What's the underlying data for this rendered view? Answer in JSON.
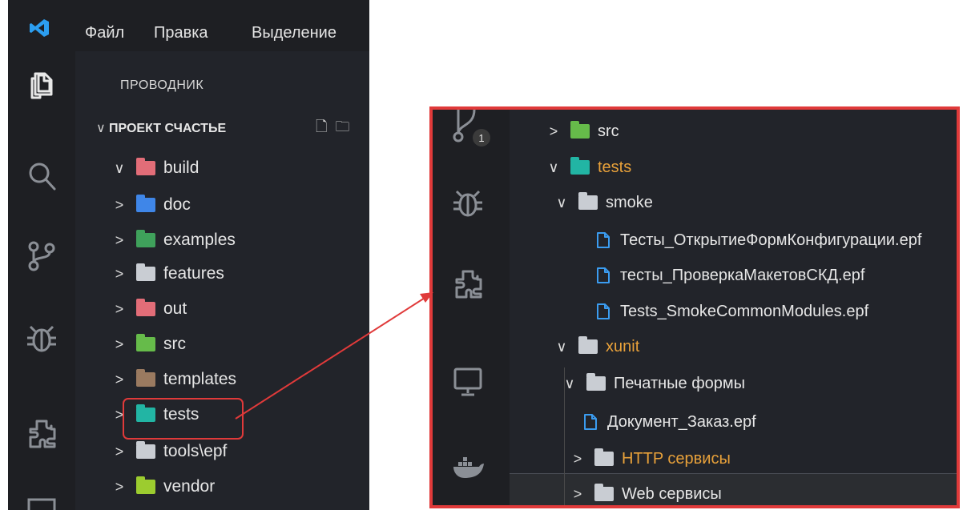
{
  "menu": {
    "items": [
      "Файл",
      "Правка",
      "Выделение"
    ]
  },
  "explorer": {
    "title": "ПРОВОДНИК",
    "project": "ПРОЕКТ СЧАСТЬЕ",
    "tree": [
      {
        "name": "build",
        "chev": "∨",
        "color": "#e26d78"
      },
      {
        "name": "doc",
        "chev": ">",
        "color": "#3f86e8"
      },
      {
        "name": "examples",
        "chev": ">",
        "color": "#3fa15b"
      },
      {
        "name": "features",
        "chev": ">",
        "color": "#c9cdd3"
      },
      {
        "name": "out",
        "chev": ">",
        "color": "#e26d78"
      },
      {
        "name": "src",
        "chev": ">",
        "color": "#66bb4a"
      },
      {
        "name": "templates",
        "chev": ">",
        "color": "#9a7a60"
      },
      {
        "name": "tests",
        "chev": ">",
        "color": "#22b5a4"
      },
      {
        "name": "tools\\epf",
        "chev": ">",
        "color": "#c9cdd3"
      },
      {
        "name": "vendor",
        "chev": ">",
        "color": "#9ccc2f"
      }
    ]
  },
  "zoom": {
    "scm_badge": "1",
    "tree": [
      {
        "name": "src",
        "chev": ">",
        "type": "folder",
        "color": "#66bb4a",
        "orange": false
      },
      {
        "name": "tests",
        "chev": "∨",
        "type": "folder",
        "color": "#22b5a4",
        "orange": true
      },
      {
        "name": "smoke",
        "chev": "∨",
        "type": "folder-open",
        "color": "#c9cdd3",
        "orange": false
      },
      {
        "name": "Тесты_ОткрытиеФормКонфигурации.epf",
        "chev": "",
        "type": "file",
        "orange": false
      },
      {
        "name": "тесты_ПроверкаМакетовСКД.epf",
        "chev": "",
        "type": "file",
        "orange": false
      },
      {
        "name": "Tests_SmokeCommonModules.epf",
        "chev": "",
        "type": "file",
        "orange": false
      },
      {
        "name": "xunit",
        "chev": "∨",
        "type": "folder-open",
        "color": "#c9cdd3",
        "orange": true
      },
      {
        "name": "Печатные формы",
        "chev": "∨",
        "type": "folder-open",
        "color": "#c9cdd3",
        "orange": false
      },
      {
        "name": "Документ_Заказ.epf",
        "chev": "",
        "type": "file",
        "orange": false
      },
      {
        "name": "HTTP сервисы",
        "chev": ">",
        "type": "folder",
        "color": "#c9cdd3",
        "orange": true
      },
      {
        "name": "Web сервисы",
        "chev": ">",
        "type": "folder",
        "color": "#c9cdd3",
        "orange": false
      }
    ]
  },
  "colors": {
    "highlight": "#e03a3a",
    "orange_text": "#e8a13a",
    "file_icon": "#3b9cf0"
  }
}
